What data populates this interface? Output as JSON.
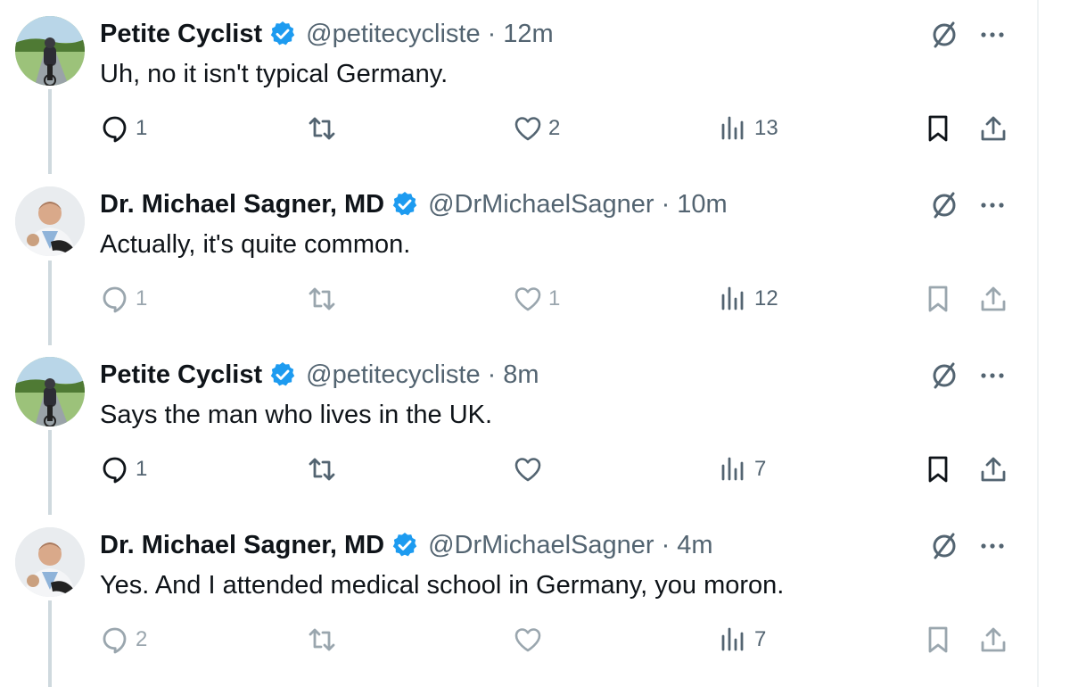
{
  "colors": {
    "verified_badge": "#1d9bf0",
    "secondary_text": "#536471",
    "thread_line": "#cfd9de"
  },
  "tweets": [
    {
      "name": "Petite Cyclist",
      "handle": "@petitecycliste",
      "time": "12m",
      "text": "Uh, no it isn't typical Germany.",
      "replies": "1",
      "reposts": "",
      "likes": "2",
      "views": "13",
      "avatar": "cyclist-avatar"
    },
    {
      "name": "Dr. Michael Sagner, MD",
      "handle": "@DrMichaelSagner",
      "time": "10m",
      "text": "Actually, it's quite common.",
      "replies": "1",
      "reposts": "",
      "likes": "1",
      "views": "12",
      "avatar": "doctor-avatar"
    },
    {
      "name": "Petite Cyclist",
      "handle": "@petitecycliste",
      "time": "8m",
      "text": "Says the man who lives in the UK.",
      "replies": "1",
      "reposts": "",
      "likes": "",
      "views": "7",
      "avatar": "cyclist-avatar"
    },
    {
      "name": "Dr. Michael Sagner, MD",
      "handle": "@DrMichaelSagner",
      "time": "4m",
      "text": "Yes. And I attended medical school in Germany, you moron.",
      "replies": "2",
      "reposts": "",
      "likes": "",
      "views": "7",
      "avatar": "doctor-avatar"
    }
  ],
  "separator": "·"
}
